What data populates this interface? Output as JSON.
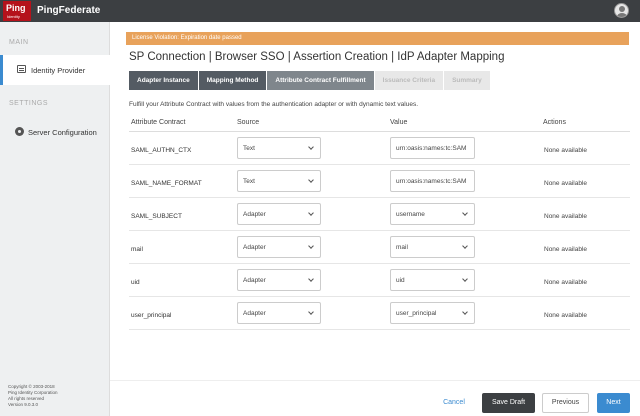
{
  "header": {
    "logo_top": "Ping",
    "logo_bottom": "Identity",
    "product": "PingFederate"
  },
  "sidebar": {
    "main_label": "MAIN",
    "settings_label": "SETTINGS",
    "items": [
      {
        "label": "Identity Provider",
        "icon": "identity-provider-icon",
        "active": true
      },
      {
        "label": "Server Configuration",
        "icon": "gear-icon",
        "active": false
      }
    ],
    "copyright": [
      "Copyright © 2003-2018",
      "Ping Identity Corporation",
      "All rights reserved",
      "Version 9.0.3.0"
    ]
  },
  "alert": "License Violation: Expiration date passed",
  "breadcrumb": "SP Connection | Browser SSO | Assertion Creation | IdP Adapter Mapping",
  "tabs": [
    {
      "label": "Adapter Instance",
      "state": "done"
    },
    {
      "label": "Mapping Method",
      "state": "done"
    },
    {
      "label": "Attribute Contract Fulfillment",
      "state": "current"
    },
    {
      "label": "Issuance Criteria",
      "state": "todo"
    },
    {
      "label": "Summary",
      "state": "todo"
    }
  ],
  "intro": "Fulfill your Attribute Contract with values from the authentication adapter or with dynamic text values.",
  "columns": {
    "contract": "Attribute Contract",
    "source": "Source",
    "value": "Value",
    "actions": "Actions"
  },
  "rows": [
    {
      "name": "SAML_AUTHN_CTX",
      "source": "Text",
      "value": "urn:oasis:names:tc:SAM",
      "value_type": "text",
      "actions": "None available"
    },
    {
      "name": "SAML_NAME_FORMAT",
      "source": "Text",
      "value": "urn:oasis:names:tc:SAM",
      "value_type": "text",
      "actions": "None available"
    },
    {
      "name": "SAML_SUBJECT",
      "source": "Adapter",
      "value": "username",
      "value_type": "select",
      "actions": "None available"
    },
    {
      "name": "mail",
      "source": "Adapter",
      "value": "mail",
      "value_type": "select",
      "actions": "None available"
    },
    {
      "name": "uid",
      "source": "Adapter",
      "value": "uid",
      "value_type": "select",
      "actions": "None available"
    },
    {
      "name": "user_principal",
      "source": "Adapter",
      "value": "user_principal",
      "value_type": "select",
      "actions": "None available"
    }
  ],
  "footer": {
    "cancel": "Cancel",
    "save_draft": "Save Draft",
    "previous": "Previous",
    "next": "Next"
  },
  "colors": {
    "alert": "#e8a25b",
    "accent": "#3b8bd0",
    "brand": "#b5121b"
  }
}
